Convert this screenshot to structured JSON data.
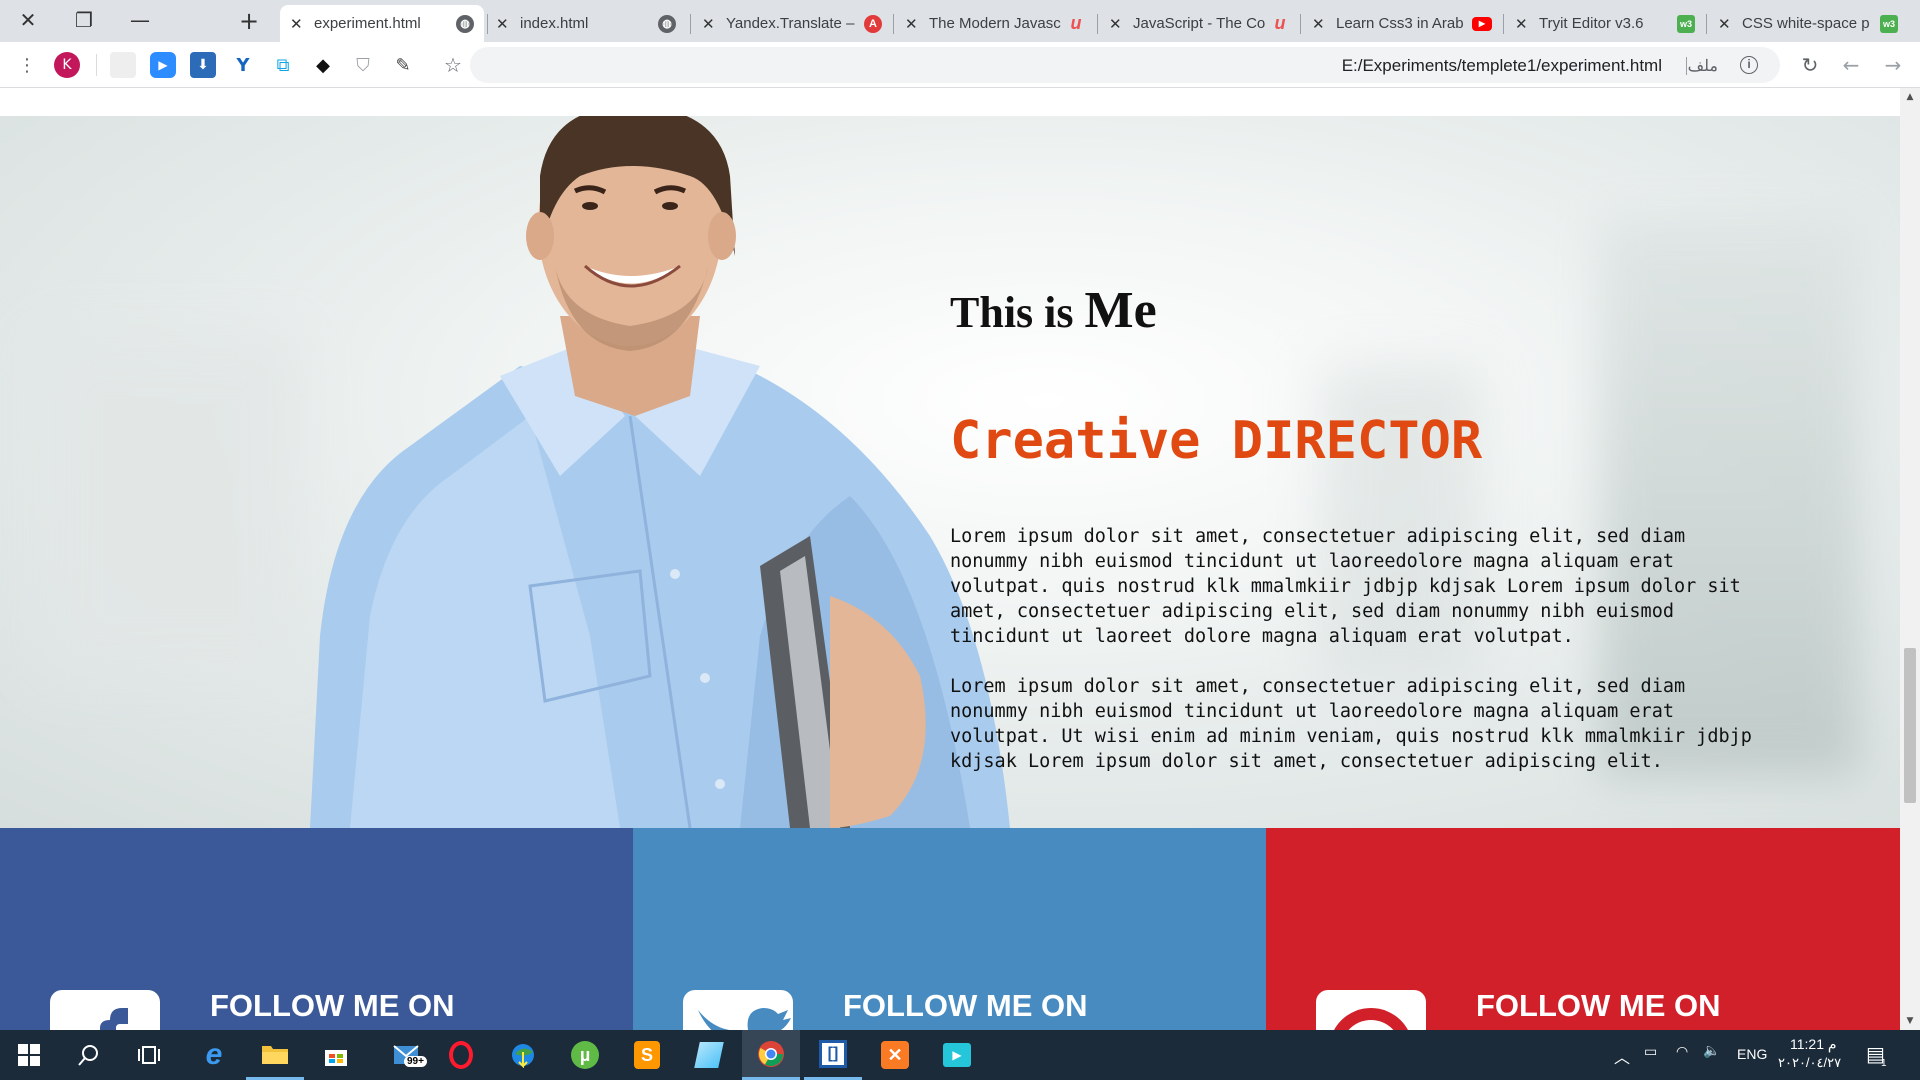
{
  "tabs": [
    {
      "title": "experiment.html",
      "active": true,
      "favicon": "globe-icon"
    },
    {
      "title": "index.html",
      "active": false,
      "favicon": "globe-icon"
    },
    {
      "title": "Yandex.Translate –",
      "active": false,
      "favicon": "yandex-icon"
    },
    {
      "title": "The Modern Javasc",
      "active": false,
      "favicon": "udemy-icon"
    },
    {
      "title": "JavaScript - The Co",
      "active": false,
      "favicon": "udemy-icon"
    },
    {
      "title": "Learn Css3 in Arab",
      "active": false,
      "favicon": "youtube-icon"
    },
    {
      "title": "Tryit Editor v3.6",
      "active": false,
      "favicon": "w3schools-icon"
    },
    {
      "title": "CSS white-space p",
      "active": false,
      "favicon": "w3schools-icon"
    }
  ],
  "toolbar": {
    "profile_initial": "K",
    "url": "E:/Experiments/templete1/experiment.html",
    "scheme_label": "ملف",
    "info": "i"
  },
  "hero": {
    "title_prefix": "This is",
    "title_bold": "Me",
    "subtitle_prefix": "Creative",
    "subtitle_bold": "DIRECTOR",
    "paragraph1": "Lorem ipsum dolor sit amet, consectetuer adipiscing elit, sed diam nonummy nibh euismod tincidunt ut laoreedolore magna aliquam erat volutpat. quis nostrud klk mmalmkiir jdbjp kdjsak Lorem ipsum dolor sit amet, consectetuer adipiscing elit, sed diam nonummy nibh euismod tincidunt ut laoreet dolore magna aliquam erat volutpat.",
    "paragraph2": "Lorem ipsum dolor sit amet, consectetuer adipiscing elit, sed diam nonummy nibh euismod tincidunt ut laoreedolore magna aliquam erat volutpat. Ut wisi enim ad minim veniam, quis nostrud klk mmalmkiir jdbjp kdjsak Lorem ipsum dolor sit amet, consectetuer adipiscing elit.",
    "accent_color": "#e04a12"
  },
  "social": [
    {
      "label": "FOLLOW ME ON",
      "network": "facebook",
      "color": "#3b5998"
    },
    {
      "label": "FOLLOW ME ON",
      "network": "twitter",
      "color": "#478bc1"
    },
    {
      "label": "FOLLOW ME ON",
      "network": "pinterest",
      "color": "#d1202a"
    }
  ],
  "taskbar": {
    "language": "ENG",
    "time": "11:21 م",
    "date": "٢٠٢٠/٠٤/٢٧",
    "mail_badge": "99+",
    "notification_count": "1"
  }
}
